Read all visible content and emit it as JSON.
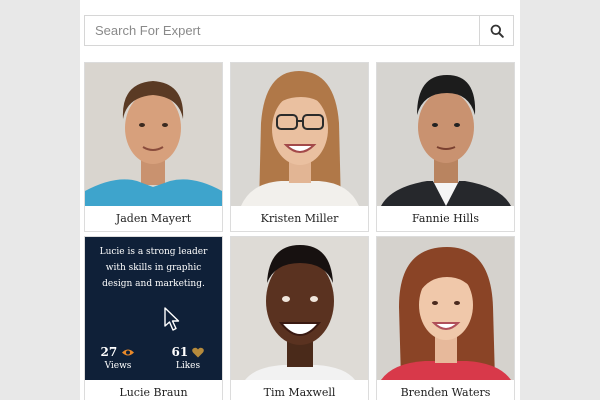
{
  "search": {
    "placeholder": "Search For Expert"
  },
  "experts": [
    {
      "name": "Jaden Mayert"
    },
    {
      "name": "Kristen Miller"
    },
    {
      "name": "Fannie Hills"
    },
    {
      "name": "Lucie Braun",
      "bio": "Lucie is a strong leader with skills in graphic design and marketing.",
      "views": "27",
      "views_label": "Views",
      "likes": "61",
      "likes_label": "Likes"
    },
    {
      "name": "Tim Maxwell"
    },
    {
      "name": "Brenden Waters"
    }
  ],
  "colors": {
    "overlay_bg": "#0f2038",
    "eye_icon": "#e8892a",
    "heart_icon": "#b58a3c"
  }
}
